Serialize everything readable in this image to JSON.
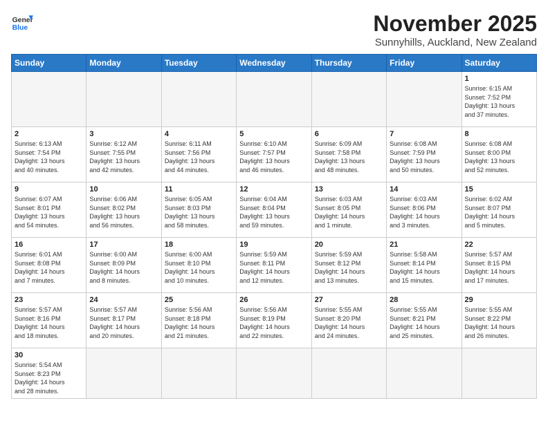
{
  "header": {
    "logo_line1": "General",
    "logo_line2": "Blue",
    "month_title": "November 2025",
    "subtitle": "Sunnyhills, Auckland, New Zealand"
  },
  "weekdays": [
    "Sunday",
    "Monday",
    "Tuesday",
    "Wednesday",
    "Thursday",
    "Friday",
    "Saturday"
  ],
  "weeks": [
    [
      {
        "day": "",
        "info": ""
      },
      {
        "day": "",
        "info": ""
      },
      {
        "day": "",
        "info": ""
      },
      {
        "day": "",
        "info": ""
      },
      {
        "day": "",
        "info": ""
      },
      {
        "day": "",
        "info": ""
      },
      {
        "day": "1",
        "info": "Sunrise: 6:15 AM\nSunset: 7:52 PM\nDaylight: 13 hours\nand 37 minutes."
      }
    ],
    [
      {
        "day": "2",
        "info": "Sunrise: 6:13 AM\nSunset: 7:54 PM\nDaylight: 13 hours\nand 40 minutes."
      },
      {
        "day": "3",
        "info": "Sunrise: 6:12 AM\nSunset: 7:55 PM\nDaylight: 13 hours\nand 42 minutes."
      },
      {
        "day": "4",
        "info": "Sunrise: 6:11 AM\nSunset: 7:56 PM\nDaylight: 13 hours\nand 44 minutes."
      },
      {
        "day": "5",
        "info": "Sunrise: 6:10 AM\nSunset: 7:57 PM\nDaylight: 13 hours\nand 46 minutes."
      },
      {
        "day": "6",
        "info": "Sunrise: 6:09 AM\nSunset: 7:58 PM\nDaylight: 13 hours\nand 48 minutes."
      },
      {
        "day": "7",
        "info": "Sunrise: 6:08 AM\nSunset: 7:59 PM\nDaylight: 13 hours\nand 50 minutes."
      },
      {
        "day": "8",
        "info": "Sunrise: 6:08 AM\nSunset: 8:00 PM\nDaylight: 13 hours\nand 52 minutes."
      }
    ],
    [
      {
        "day": "9",
        "info": "Sunrise: 6:07 AM\nSunset: 8:01 PM\nDaylight: 13 hours\nand 54 minutes."
      },
      {
        "day": "10",
        "info": "Sunrise: 6:06 AM\nSunset: 8:02 PM\nDaylight: 13 hours\nand 56 minutes."
      },
      {
        "day": "11",
        "info": "Sunrise: 6:05 AM\nSunset: 8:03 PM\nDaylight: 13 hours\nand 58 minutes."
      },
      {
        "day": "12",
        "info": "Sunrise: 6:04 AM\nSunset: 8:04 PM\nDaylight: 13 hours\nand 59 minutes."
      },
      {
        "day": "13",
        "info": "Sunrise: 6:03 AM\nSunset: 8:05 PM\nDaylight: 14 hours\nand 1 minute."
      },
      {
        "day": "14",
        "info": "Sunrise: 6:03 AM\nSunset: 8:06 PM\nDaylight: 14 hours\nand 3 minutes."
      },
      {
        "day": "15",
        "info": "Sunrise: 6:02 AM\nSunset: 8:07 PM\nDaylight: 14 hours\nand 5 minutes."
      }
    ],
    [
      {
        "day": "16",
        "info": "Sunrise: 6:01 AM\nSunset: 8:08 PM\nDaylight: 14 hours\nand 7 minutes."
      },
      {
        "day": "17",
        "info": "Sunrise: 6:00 AM\nSunset: 8:09 PM\nDaylight: 14 hours\nand 8 minutes."
      },
      {
        "day": "18",
        "info": "Sunrise: 6:00 AM\nSunset: 8:10 PM\nDaylight: 14 hours\nand 10 minutes."
      },
      {
        "day": "19",
        "info": "Sunrise: 5:59 AM\nSunset: 8:11 PM\nDaylight: 14 hours\nand 12 minutes."
      },
      {
        "day": "20",
        "info": "Sunrise: 5:59 AM\nSunset: 8:12 PM\nDaylight: 14 hours\nand 13 minutes."
      },
      {
        "day": "21",
        "info": "Sunrise: 5:58 AM\nSunset: 8:14 PM\nDaylight: 14 hours\nand 15 minutes."
      },
      {
        "day": "22",
        "info": "Sunrise: 5:57 AM\nSunset: 8:15 PM\nDaylight: 14 hours\nand 17 minutes."
      }
    ],
    [
      {
        "day": "23",
        "info": "Sunrise: 5:57 AM\nSunset: 8:16 PM\nDaylight: 14 hours\nand 18 minutes."
      },
      {
        "day": "24",
        "info": "Sunrise: 5:57 AM\nSunset: 8:17 PM\nDaylight: 14 hours\nand 20 minutes."
      },
      {
        "day": "25",
        "info": "Sunrise: 5:56 AM\nSunset: 8:18 PM\nDaylight: 14 hours\nand 21 minutes."
      },
      {
        "day": "26",
        "info": "Sunrise: 5:56 AM\nSunset: 8:19 PM\nDaylight: 14 hours\nand 22 minutes."
      },
      {
        "day": "27",
        "info": "Sunrise: 5:55 AM\nSunset: 8:20 PM\nDaylight: 14 hours\nand 24 minutes."
      },
      {
        "day": "28",
        "info": "Sunrise: 5:55 AM\nSunset: 8:21 PM\nDaylight: 14 hours\nand 25 minutes."
      },
      {
        "day": "29",
        "info": "Sunrise: 5:55 AM\nSunset: 8:22 PM\nDaylight: 14 hours\nand 26 minutes."
      }
    ],
    [
      {
        "day": "30",
        "info": "Sunrise: 5:54 AM\nSunset: 8:23 PM\nDaylight: 14 hours\nand 28 minutes."
      },
      {
        "day": "",
        "info": ""
      },
      {
        "day": "",
        "info": ""
      },
      {
        "day": "",
        "info": ""
      },
      {
        "day": "",
        "info": ""
      },
      {
        "day": "",
        "info": ""
      },
      {
        "day": "",
        "info": ""
      }
    ]
  ]
}
